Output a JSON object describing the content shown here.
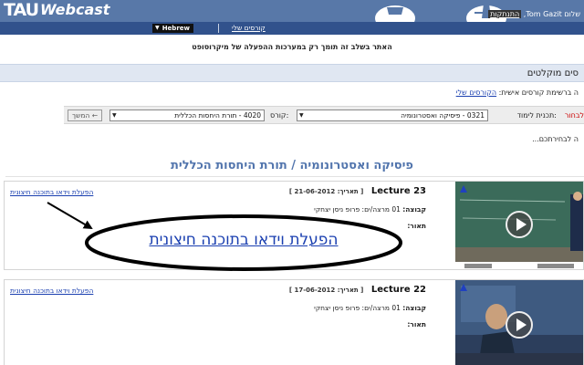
{
  "header": {
    "logo_main": "TAU",
    "logo_sub": "Webcast",
    "user_greeting": "שלום Tom Gazit,",
    "logout_label": "התנתקות"
  },
  "topnav": {
    "language_label": "Hebrew",
    "my_courses_label": "קורסים שלי"
  },
  "notice": "האתר בשלב זה תומך רק במערכות ההפעלה של מיקרוסופט",
  "section": {
    "title": "סים מוקלטים",
    "personal_list_text": "ה ברשימת קורסים אישית:",
    "personal_list_link": "הקורסים שלי"
  },
  "filter": {
    "choose_label": "לבחור",
    "program_label": "תכנית לימוד:",
    "program_value": "0321 - פיסיקה ואסטרונומיה",
    "course_label": "קורס:",
    "course_value": "4020 - תורת היחסות הכללית",
    "next_label": "המשך ←"
  },
  "choose_note": "ה לבחירתכם...",
  "course_heading": "פיסיקה ואסטרונומיה / תורת היחסות הכללית",
  "lectures": [
    {
      "name": "Lecture 23",
      "date": "[ תאריך: 21-06-2012 ]",
      "group_label": "קבוצה:",
      "group_value": "01 מרצה/ים: פרופ ניסן יצחקי",
      "desc_label": "תאור:",
      "link_label": "הפעלת וידאו בתוכנה חיצונית"
    },
    {
      "name": "Lecture 22",
      "date": "[ תאריך: 17-06-2012 ]",
      "group_label": "קבוצה:",
      "group_value": "01 מרצה/ים: פרופ ניסן יצחקי",
      "desc_label": "תאור:",
      "link_label": "הפעלת וידאו בתוכנה חיצונית"
    }
  ],
  "annotation": {
    "enlarged_link_label": "הפעלת וידאו בתוכנה חיצונית"
  },
  "colors": {
    "header_bg": "#5878a8",
    "nav_bg": "#31528c",
    "title_blue": "#5275ad",
    "link_blue": "#1a3fb0",
    "choose_red": "#cc0000"
  }
}
